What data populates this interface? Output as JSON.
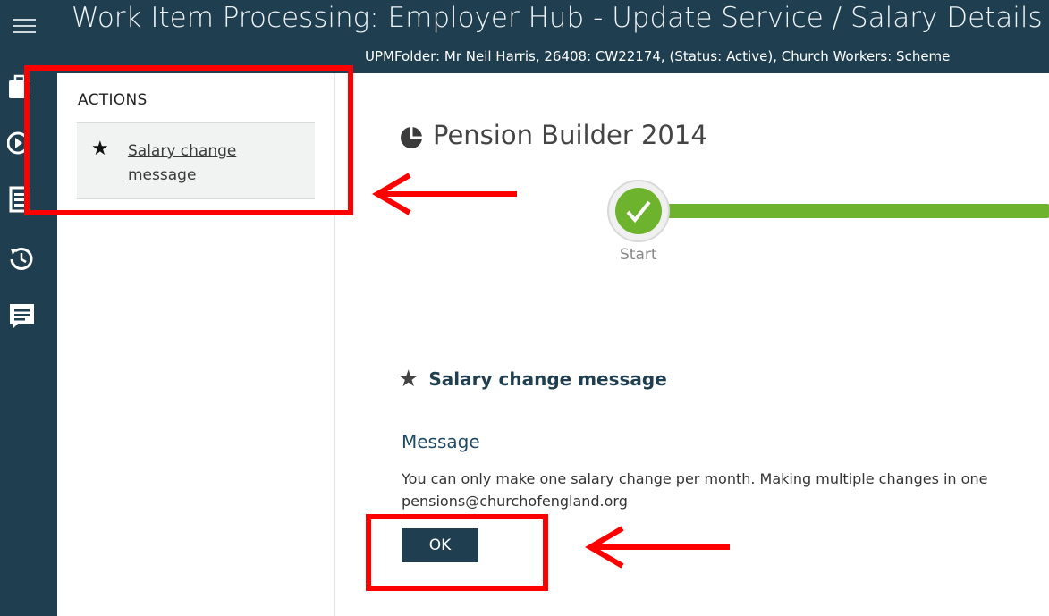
{
  "header": {
    "title": "Work Item Processing: Employer Hub - Update Service / Salary Details",
    "subtitle": "UPMFolder: Mr Neil Harris, 26408: CW22174, (Status: Active), Church Workers: Scheme"
  },
  "rail": {
    "icons": [
      "menu-icon",
      "briefcase-icon",
      "play-circle-icon",
      "document-icon",
      "history-icon",
      "chat-icon"
    ]
  },
  "actions": {
    "title": "ACTIONS",
    "item_label": "Salary change message"
  },
  "process": {
    "title": "Pension Builder 2014",
    "start_label": "Start"
  },
  "section": {
    "title": "Salary change message",
    "message_label": "Message",
    "message_line1": "You can only make one salary change per month. Making multiple changes in one",
    "message_line2": "pensions@churchofengland.org",
    "ok_label": "OK"
  },
  "colors": {
    "header_bg": "#1f3f51",
    "progress_green": "#6eb32d",
    "annotation_red": "#ff0000"
  }
}
